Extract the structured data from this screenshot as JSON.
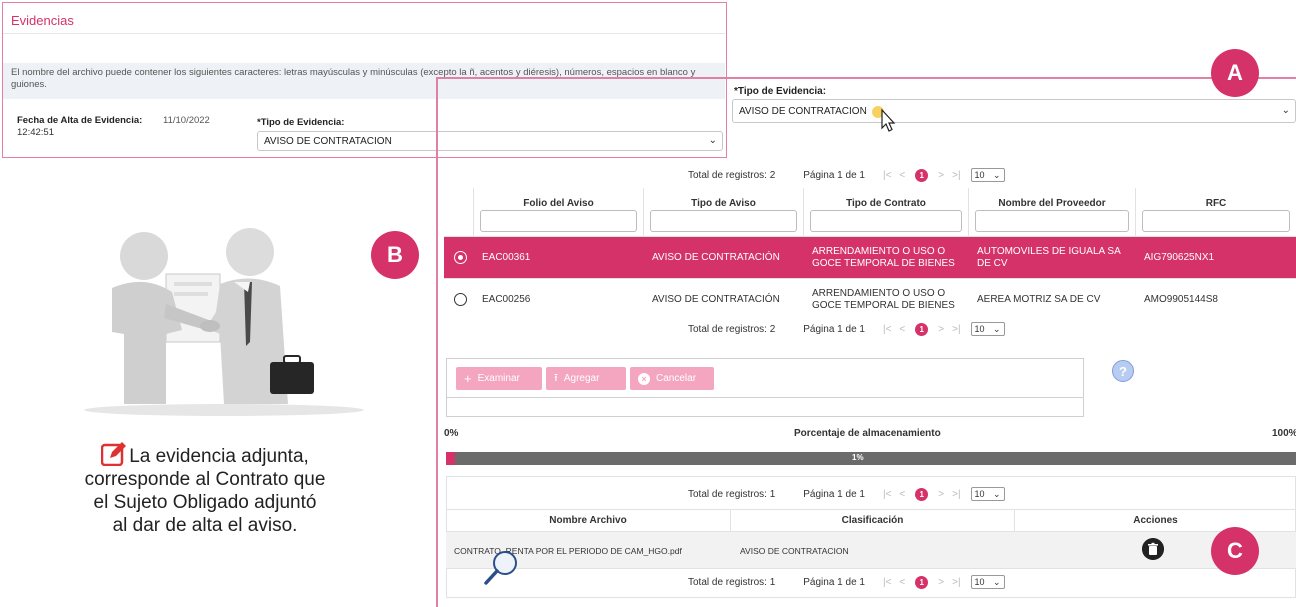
{
  "evidencias_panel": {
    "title": "Evidencias",
    "note": "El nombre del archivo puede contener los siguientes caracteres: letras mayúsculas y minúsculas (excepto la ñ, acentos y diéresis), números, espacios en blanco y guiones.",
    "fecha_label": "Fecha de Alta de Evidencia:",
    "fecha_value": "11/10/2022",
    "fecha_time": "12:42:51",
    "tipo_label": "*Tipo de Evidencia:",
    "tipo_value": "AVISO DE CONTRATACION"
  },
  "main_panel": {
    "tipo_label": "*Tipo de Evidencia:",
    "tipo_value": "AVISO DE CONTRATACION"
  },
  "pager": {
    "total_2": "Total de registros: 2",
    "total_1": "Total de registros: 1",
    "page": "Página 1 de 1",
    "current": "1",
    "size": "10",
    "first": "|<",
    "prev": "<",
    "next": ">",
    "last": ">|"
  },
  "avisos_table": {
    "columns": [
      "Folio del Aviso",
      "Tipo de Aviso",
      "Tipo de Contrato",
      "Nombre del Proveedor",
      "RFC"
    ],
    "rows": [
      {
        "folio": "EAC00361",
        "tipo_aviso": "AVISO DE CONTRATACIÓN",
        "tipo_contrato": "ARRENDAMIENTO O USO O GOCE TEMPORAL DE BIENES",
        "proveedor": "AUTOMOVILES DE IGUALA SA DE CV",
        "rfc": "AIG790625NX1",
        "selected": true
      },
      {
        "folio": "EAC00256",
        "tipo_aviso": "AVISO DE CONTRATACIÓN",
        "tipo_contrato": "ARRENDAMIENTO O USO O GOCE TEMPORAL DE BIENES",
        "proveedor": "AEREA MOTRIZ SA DE CV",
        "rfc": "AMO9905144S8",
        "selected": false
      }
    ]
  },
  "upload": {
    "examinar": "Examinar",
    "agregar": "Agregar",
    "cancelar": "Cancelar",
    "help": "?"
  },
  "storage": {
    "min_label": "0%",
    "label": "Porcentaje de almacenamiento",
    "max_label": "100%",
    "percent_text": "1%",
    "percent": 0.01
  },
  "files_table": {
    "columns": [
      "Nombre Archivo",
      "Clasificación",
      "Acciones"
    ],
    "rows": [
      {
        "nombre": "CONTRATO_RENTA POR EL PERIODO DE CAM_HGO.pdf",
        "clasificacion": "AVISO DE CONTRATACION"
      }
    ]
  },
  "callouts": {
    "a": "A",
    "b": "B",
    "c": "C"
  },
  "caption": {
    "line1": "La evidencia adjunta,",
    "line2": "corresponde al Contrato que",
    "line3": "el Sujeto Obligado adjuntó",
    "line4": "al dar de alta el aviso."
  },
  "colors": {
    "accent": "#d5326a",
    "border": "#e27fa6",
    "button_disabled": "#f4a6c0",
    "progress_track": "#6b6b6b"
  }
}
